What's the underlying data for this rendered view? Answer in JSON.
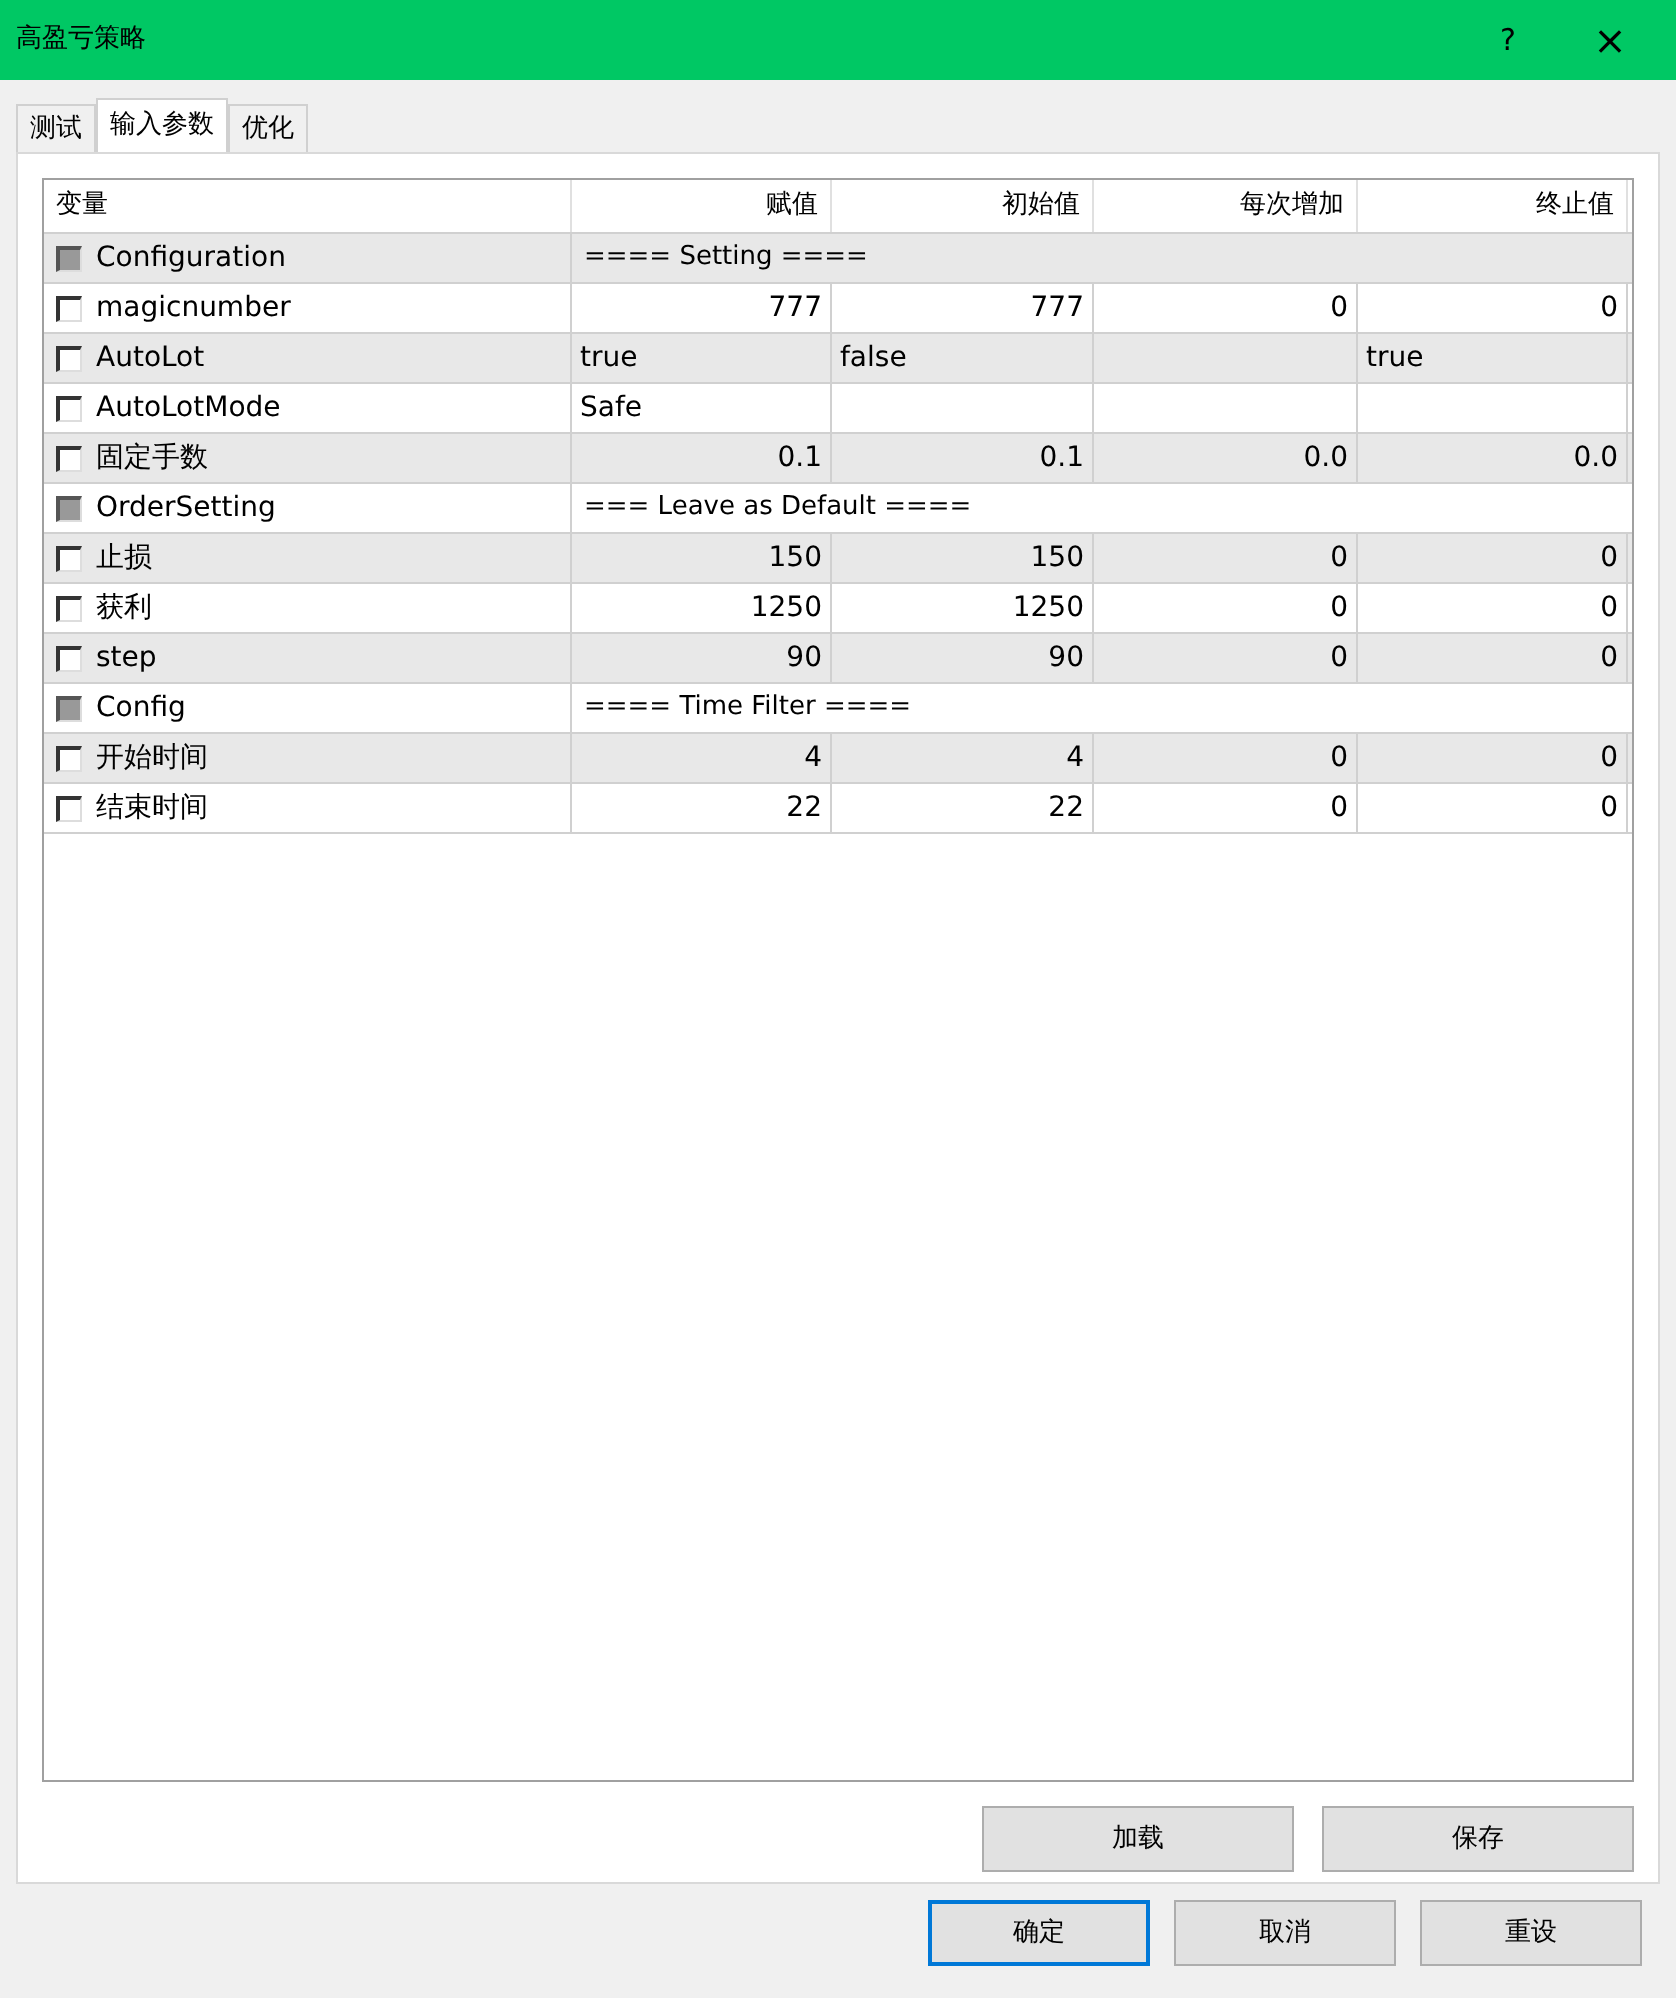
{
  "window": {
    "title": "高盈亏策略",
    "help": "?",
    "close": "×"
  },
  "tabs": [
    {
      "label": "测试",
      "selected": false
    },
    {
      "label": "输入参数",
      "selected": true
    },
    {
      "label": "优化",
      "selected": false
    }
  ],
  "table": {
    "columns": [
      "变量",
      "赋值",
      "初始值",
      "每次增加",
      "终止值"
    ],
    "rows": [
      {
        "kind": "group",
        "checked": false,
        "cells": [
          "Configuration",
          "==== Setting ===="
        ]
      },
      {
        "kind": "number",
        "checked": false,
        "cells": [
          "magicnumber",
          "777",
          "777",
          "0",
          "0"
        ]
      },
      {
        "kind": "text",
        "checked": false,
        "cells": [
          "AutoLot",
          "true",
          "false",
          "",
          "true"
        ]
      },
      {
        "kind": "text",
        "checked": false,
        "cells": [
          "AutoLotMode",
          "Safe",
          "",
          "",
          ""
        ]
      },
      {
        "kind": "number",
        "checked": false,
        "cells": [
          "固定手数",
          "0.1",
          "0.1",
          "0.0",
          "0.0"
        ]
      },
      {
        "kind": "group",
        "checked": false,
        "cells": [
          "OrderSetting",
          "=== Leave as Default ===="
        ]
      },
      {
        "kind": "number",
        "checked": false,
        "cells": [
          "止损",
          "150",
          "150",
          "0",
          "0"
        ]
      },
      {
        "kind": "number",
        "checked": false,
        "cells": [
          "获利",
          "1250",
          "1250",
          "0",
          "0"
        ]
      },
      {
        "kind": "number",
        "checked": false,
        "cells": [
          "step",
          "90",
          "90",
          "0",
          "0"
        ]
      },
      {
        "kind": "group",
        "checked": false,
        "cells": [
          "Config",
          "==== Time Filter ===="
        ]
      },
      {
        "kind": "number",
        "checked": false,
        "cells": [
          "开始时间",
          "4",
          "4",
          "0",
          "0"
        ]
      },
      {
        "kind": "number",
        "checked": false,
        "cells": [
          "结束时间",
          "22",
          "22",
          "0",
          "0"
        ]
      }
    ]
  },
  "panel_buttons": [
    "加载",
    "保存"
  ],
  "dialog_buttons": [
    {
      "label": "确定",
      "default": true
    },
    {
      "label": "取消",
      "default": false
    },
    {
      "label": "重设",
      "default": false
    }
  ]
}
